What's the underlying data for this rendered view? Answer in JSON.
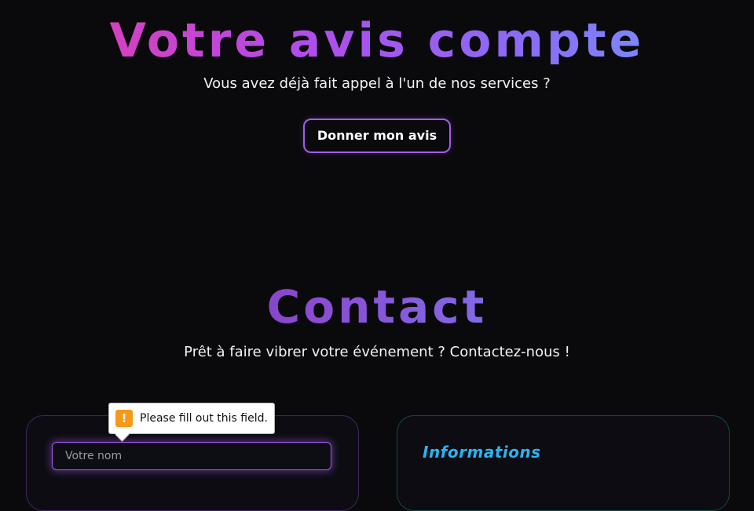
{
  "reviews": {
    "title": "Votre avis compte",
    "subtitle": "Vous avez déjà fait appel à l'un de nos services ?",
    "button_label": "Donner mon avis"
  },
  "contact": {
    "title": "Contact",
    "subtitle": "Prêt à faire vibrer votre événement ? Contactez-nous !",
    "form": {
      "name_placeholder": "Votre nom",
      "name_value": ""
    },
    "info": {
      "title": "Informations"
    }
  },
  "validation_tooltip": {
    "message": "Please fill out this field.",
    "icon": "warning-icon",
    "icon_glyph": "!"
  },
  "colors": {
    "background": "#0a0a0d",
    "accent_purple": "#a35de8",
    "accent_pink": "#e83aa8",
    "accent_blue": "#6ea0ff",
    "info_title": "#2bb3f0",
    "warning": "#f59a18"
  }
}
